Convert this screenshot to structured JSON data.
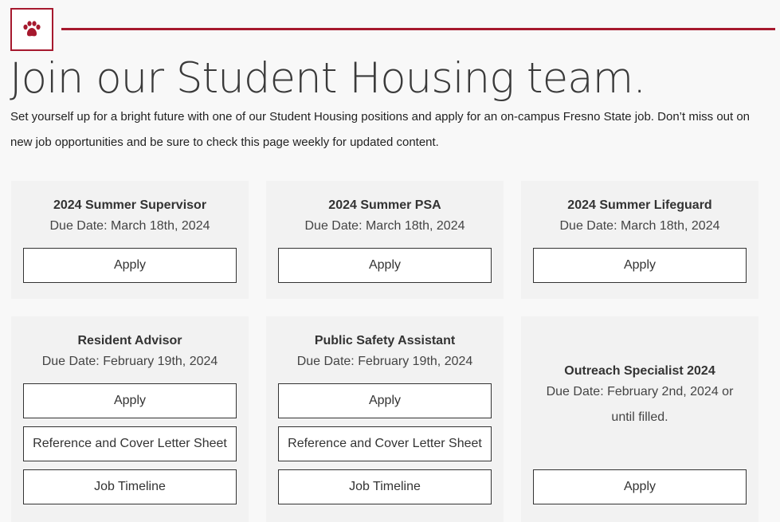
{
  "header": {
    "logo_icon": "paw-icon",
    "accent_color": "#a6192e",
    "title": "Join our Student Housing team.",
    "intro": "Set yourself up for a bright future with one of our Student Housing positions and apply for an on-campus Fresno State job. Don’t miss out on new job opportunities and be sure to check this page weekly for updated content."
  },
  "jobs": [
    {
      "title": "2024 Summer Supervisor",
      "due": "Due Date: March 18th, 2024",
      "apply": "Apply"
    },
    {
      "title": "2024 Summer PSA",
      "due": "Due Date: March 18th, 2024",
      "apply": "Apply"
    },
    {
      "title": "2024 Summer Lifeguard",
      "due": "Due Date: March 18th, 2024",
      "apply": "Apply"
    },
    {
      "title": "Resident Advisor",
      "due": "Due Date: February 19th, 2024",
      "apply": "Apply",
      "reference": "Reference and Cover Letter Sheet",
      "timeline": "Job Timeline"
    },
    {
      "title": "Public Safety Assistant",
      "due": "Due Date: February 19th, 2024",
      "apply": "Apply",
      "reference": "Reference and Cover Letter Sheet",
      "timeline": "Job Timeline"
    },
    {
      "title": "Outreach Specialist 2024",
      "due": "Due Date: February 2nd, 2024 or until filled.",
      "apply": "Apply"
    }
  ]
}
